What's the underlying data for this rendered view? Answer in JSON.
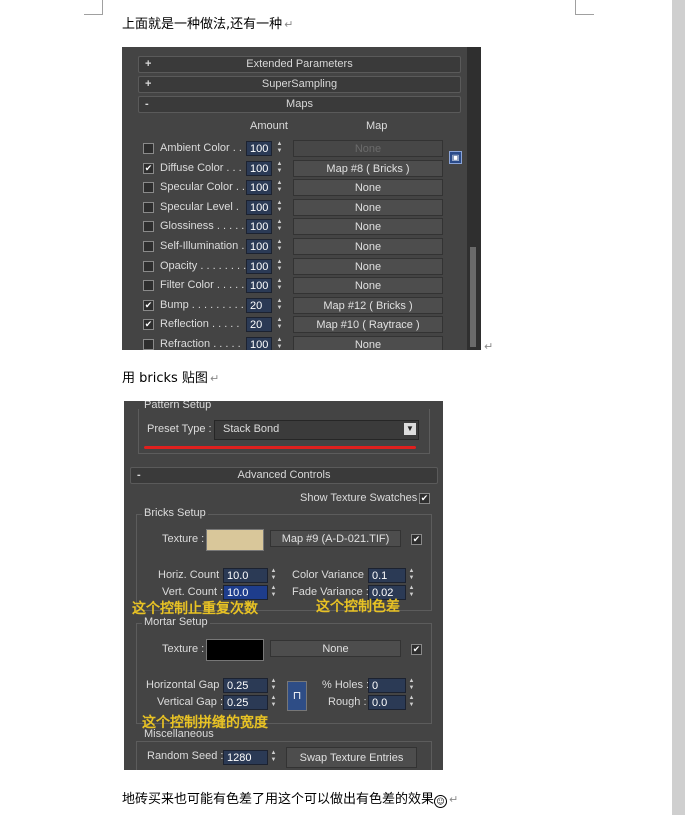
{
  "doc": {
    "line1": "上面就是一种做法,还有一种",
    "line2": "用 bricks 贴图",
    "line3": "地砖买来也可能有色差了用这个可以做出有色差的效果",
    "line3_icon": "smiley-icon",
    "paragraph_mark": "↵"
  },
  "maps_panel": {
    "rollouts": [
      {
        "sign": "+",
        "label": "Extended Parameters"
      },
      {
        "sign": "+",
        "label": "SuperSampling"
      },
      {
        "sign": "-",
        "label": "Maps"
      }
    ],
    "headers": {
      "amount": "Amount",
      "map": "Map"
    },
    "rows": [
      {
        "checked": false,
        "label": "Ambient Color . . .",
        "amount": "100",
        "map": "None",
        "dim": true
      },
      {
        "checked": true,
        "label": "Diffuse Color . . .",
        "amount": "100",
        "map": "Map #8  ( Bricks )",
        "dim": false
      },
      {
        "checked": false,
        "label": "Specular Color  . .",
        "amount": "100",
        "map": "None",
        "dim": false
      },
      {
        "checked": false,
        "label": "Specular Level  .",
        "amount": "100",
        "map": "None",
        "dim": false
      },
      {
        "checked": false,
        "label": "Glossiness  . . . . .",
        "amount": "100",
        "map": "None",
        "dim": false
      },
      {
        "checked": false,
        "label": "Self-Illumination .",
        "amount": "100",
        "map": "None",
        "dim": false
      },
      {
        "checked": false,
        "label": "Opacity . . . . . . . .",
        "amount": "100",
        "map": "None",
        "dim": false
      },
      {
        "checked": false,
        "label": "Filter Color  . . . . .",
        "amount": "100",
        "map": "None",
        "dim": false
      },
      {
        "checked": true,
        "label": "Bump  . . . . . . . . .",
        "amount": "20",
        "map": "Map #12  ( Bricks )",
        "dim": false
      },
      {
        "checked": true,
        "label": "Reflection  . . . . .",
        "amount": "20",
        "map": "Map #10  ( Raytrace )",
        "dim": false
      },
      {
        "checked": false,
        "label": "Refraction  . . . . .",
        "amount": "100",
        "map": "None",
        "dim": false
      }
    ]
  },
  "bricks_panel": {
    "pattern_setup": "Pattern Setup",
    "preset_type_label": "Preset Type :",
    "preset_type_value": "Stack Bond",
    "advanced_controls": "Advanced Controls",
    "advanced_sign": "-",
    "show_swatches": "Show Texture Swatches",
    "bricks_setup": "Bricks Setup",
    "texture_label": "Texture :",
    "bricks_map": "Map #9 (A-D-021.TIF)",
    "horiz_label": "Horiz. Count :",
    "horiz_value": "10.0",
    "vert_label": "Vert. Count :",
    "vert_value": "10.0",
    "colorvar_label": "Color Variance :",
    "colorvar_value": "0.1",
    "fadevar_label": "Fade Variance :",
    "fadevar_value": "0.02",
    "mortar_setup": "Mortar Setup",
    "mortar_texture_label": "Texture :",
    "mortar_map": "None",
    "hgap_label": "Horizontal Gap :",
    "hgap_value": "0.25",
    "vgap_label": "Vertical Gap :",
    "vgap_value": "0.25",
    "holes_label": "% Holes :",
    "holes_value": "0",
    "rough_label": "Rough :",
    "rough_value": "0.0",
    "misc": "Miscellaneous",
    "seed_label": "Random Seed :",
    "seed_value": "1280",
    "swap_button": "Swap Texture Entries",
    "colors": {
      "brick_swatch": "#d9c79a",
      "mortar_swatch": "#000000",
      "underline": "#e0201e"
    }
  },
  "annotations": {
    "repeat": "这个控制止重复次数",
    "color_diff": "这个控制色差",
    "gap_width": "这个控制拼缝的宽度"
  }
}
